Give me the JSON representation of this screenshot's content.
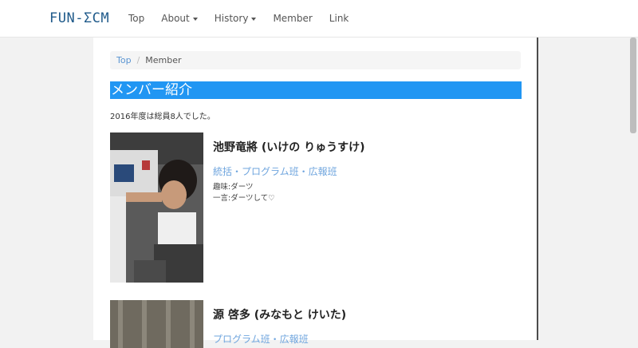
{
  "nav": {
    "brand": "FUN-ΣCM",
    "items": [
      {
        "label": "Top",
        "dropdown": false
      },
      {
        "label": "About",
        "dropdown": true
      },
      {
        "label": "History",
        "dropdown": true
      },
      {
        "label": "Member",
        "dropdown": false
      },
      {
        "label": "Link",
        "dropdown": false
      }
    ]
  },
  "breadcrumb": {
    "home": "Top",
    "separator": "/",
    "current": "Member"
  },
  "page": {
    "title": "メンバー紹介",
    "total": "2016年度は総員8人でした。"
  },
  "members": [
    {
      "name": "池野竜將 (いけの りゅうすけ)",
      "roles": "統括・プログラム班・広報班",
      "hobby": "趣味:ダーツ",
      "comment": "一言:ダーツして♡"
    },
    {
      "name": "源 啓多 (みなもと けいた)",
      "roles": "プログラム班・広報班"
    }
  ],
  "colors": {
    "accent": "#2196f3",
    "link": "#5b95d2",
    "role": "#6fa5de",
    "brand": "#1f5a8a"
  }
}
